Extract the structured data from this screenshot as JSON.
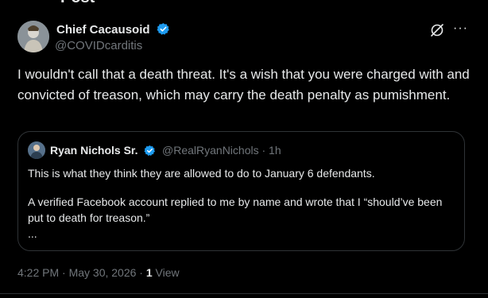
{
  "header": {
    "back_icon": "back-arrow-icon",
    "back_glyph": "←",
    "title": "Post"
  },
  "post": {
    "author_name": "Chief Cacausoid",
    "author_handle": "@COVIDcarditis",
    "text": "I wouldn't call that a death threat.  It's a wish that you were charged with and convicted of treason, which may carry the death penalty as pumishment.",
    "more_glyph": "···"
  },
  "quote": {
    "author_name": "Ryan Nichols Sr.",
    "meta": "@RealRyanNichols · 1h",
    "paragraph1": "This is what they think they are allowed to do to January 6 defendants.",
    "paragraph2": "A verified Facebook account replied to me by name and wrote that I “should’ve been put to death for treason.”",
    "ellipsis": "..."
  },
  "footer": {
    "timestamp": "4:22 PM · May 30, 2026 · ",
    "view_count": "1",
    "view_label": " View"
  },
  "colors": {
    "background": "#000000",
    "text": "#e7e9ea",
    "muted": "#71767b",
    "verified": "#1d9bf0",
    "border": "#2f3336"
  }
}
